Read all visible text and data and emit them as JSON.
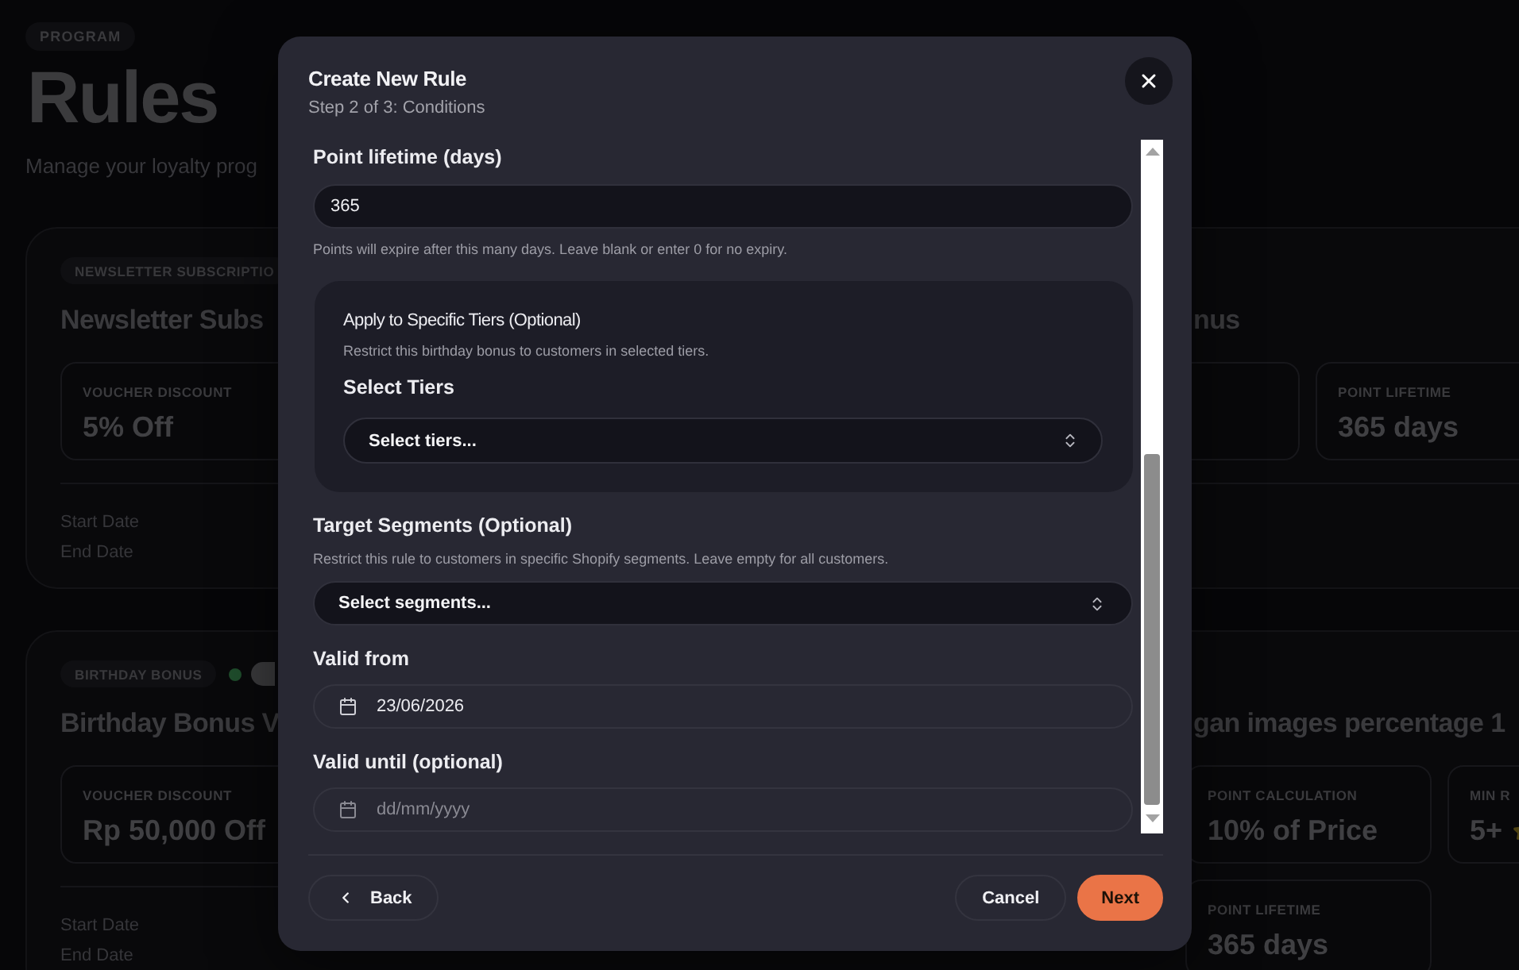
{
  "page": {
    "eyebrow": "PROGRAM",
    "title": "Rules",
    "subtitle": "Manage your loyalty prog"
  },
  "rule_cards": [
    {
      "badge": "NEWSLETTER SUBSCRIPTIO",
      "title": "Newsletter Subs",
      "title_end": "nus",
      "metrics": [
        {
          "kind": "stat",
          "label": "VOUCHER DISCOUNT",
          "value": "5% Off"
        },
        {
          "kind": "blank"
        },
        {
          "kind": "stat",
          "label": "POINT LIFETIME",
          "value": "365 days"
        }
      ],
      "dates": [
        "Start Date",
        "End Date"
      ]
    },
    {
      "badge": "BIRTHDAY BONUS",
      "active": true,
      "title": "Birthday Bonus V",
      "title_end": "gan images percentage 1",
      "metrics": [
        {
          "kind": "stat",
          "label": "VOUCHER DISCOUNT",
          "value": "Rp 50,000 Off"
        },
        {
          "kind": "stat",
          "label": "POINT CALCULATION",
          "value": "10% of Price"
        },
        {
          "kind": "rating",
          "label": "MIN R",
          "value": "5+"
        },
        {
          "kind": "stat",
          "label": "POINT LIFETIME",
          "value": "365 days"
        }
      ],
      "dates": [
        "Start Date",
        "End Date"
      ]
    }
  ],
  "dialog": {
    "title": "Create New Rule",
    "subtitle": "Step 2 of 3: Conditions",
    "fields": [
      {
        "kind": "number",
        "label": "Point lifetime (days)",
        "value": "365",
        "hint": "Points will expire after this many days. Leave blank or enter 0 for no expiry."
      },
      {
        "kind": "tier_panel",
        "heading": "Apply to Specific Tiers (Optional)",
        "description": "Restrict this birthday bonus to customers in selected tiers.",
        "label": "Select Tiers",
        "placeholder": "Select tiers..."
      },
      {
        "kind": "select",
        "label": "Target Segments (Optional)",
        "hint": "Restrict this rule to customers in specific Shopify segments. Leave empty for all customers.",
        "placeholder": "Select segments..."
      },
      {
        "kind": "date",
        "label": "Valid from",
        "value": "23/06/2026"
      },
      {
        "kind": "date",
        "label": "Valid until (optional)",
        "placeholder": "dd/mm/yyyy"
      }
    ],
    "buttons": [
      {
        "kind": "back",
        "label": "Back"
      },
      {
        "kind": "cancel",
        "label": "Cancel"
      },
      {
        "kind": "next",
        "label": "Next"
      }
    ]
  }
}
